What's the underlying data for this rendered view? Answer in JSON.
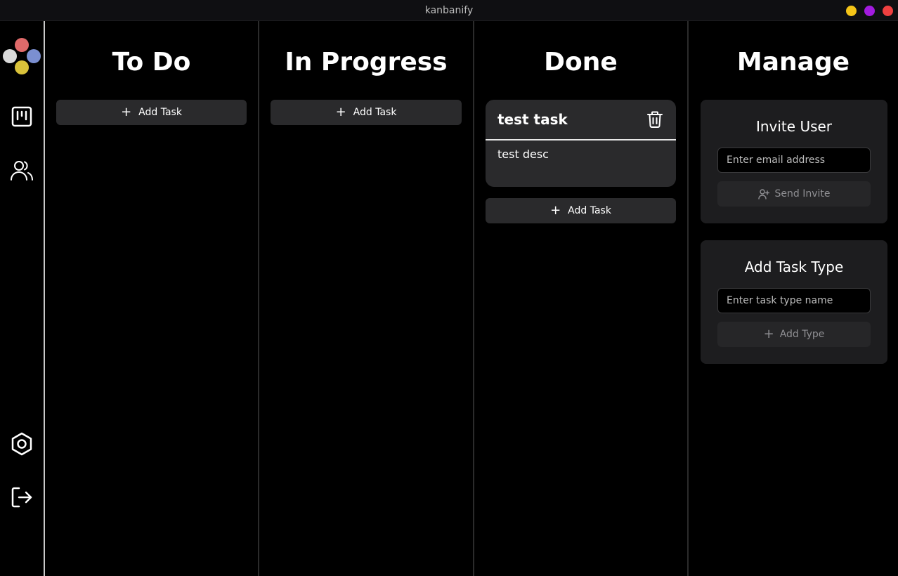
{
  "window": {
    "title": "kanbanify",
    "controls": [
      {
        "name": "minimize",
        "color": "#f5c518"
      },
      {
        "name": "maximize",
        "color": "#a31be0"
      },
      {
        "name": "close",
        "color": "#f04040"
      }
    ]
  },
  "sidebar": {
    "logo_colors": [
      "#e06a6a",
      "#d9d9d9",
      "#7b8fd1",
      "#d9c23a"
    ],
    "items": [
      {
        "icon": "board-icon"
      },
      {
        "icon": "users-icon"
      },
      {
        "icon": "settings-icon"
      },
      {
        "icon": "logout-icon"
      }
    ]
  },
  "columns": [
    {
      "title": "To Do",
      "add_label": "Add Task"
    },
    {
      "title": "In Progress",
      "add_label": "Add Task"
    },
    {
      "title": "Done",
      "add_label": "Add Task",
      "tasks": [
        {
          "title": "test task",
          "description": "test desc"
        }
      ]
    }
  ],
  "manage": {
    "title": "Manage",
    "invite": {
      "title": "Invite User",
      "placeholder": "Enter email address",
      "button_label": "Send Invite"
    },
    "task_type": {
      "title": "Add Task Type",
      "placeholder": "Enter task type name",
      "button_label": "Add Type"
    }
  }
}
